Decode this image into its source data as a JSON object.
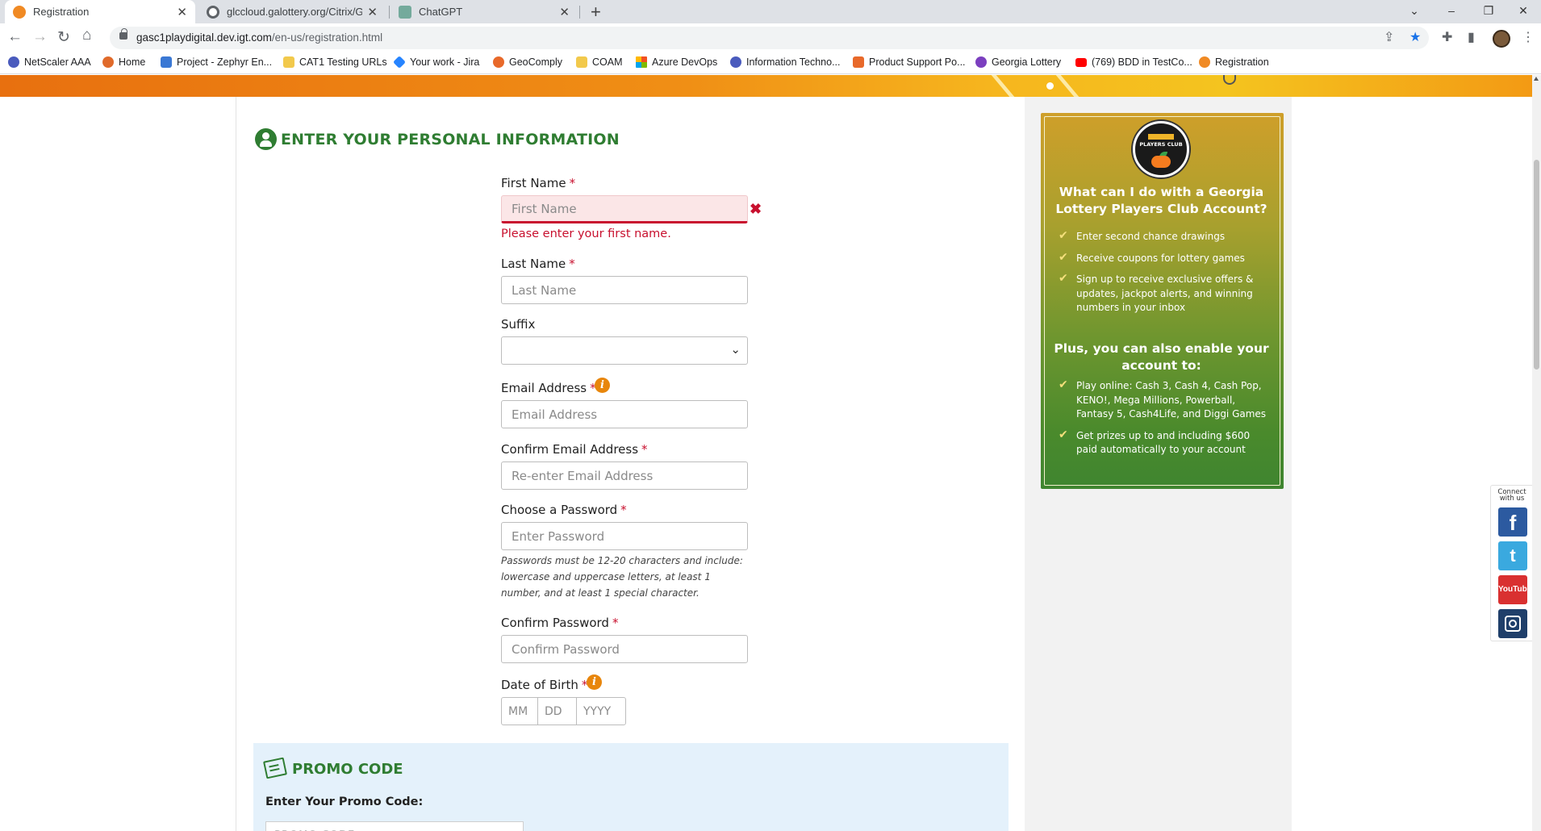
{
  "browser": {
    "tabs": [
      {
        "title": "Registration",
        "favicon_color": "#f08a24",
        "active": true
      },
      {
        "title": "glccloud.galottery.org/Citrix/GLC",
        "favicon_color": "#5f6368",
        "active": false
      },
      {
        "title": "ChatGPT",
        "favicon_color": "#74aa9c",
        "active": false
      }
    ],
    "url_host": "gasc1playdigital.dev.igt.com",
    "url_path": "/en-us/registration.html",
    "bookmarks": [
      {
        "label": "NetScaler AAA",
        "icon_color": "#4a5bbd"
      },
      {
        "label": "Home",
        "icon_color": "#e06a2a"
      },
      {
        "label": "Project - Zephyr En...",
        "icon_color": "#3a78d4"
      },
      {
        "label": "CAT1 Testing URLs",
        "icon_color": "#f2c94c"
      },
      {
        "label": "Your work - Jira",
        "icon_color": "#2684ff"
      },
      {
        "label": "GeoComply",
        "icon_color": "#e8692a"
      },
      {
        "label": "COAM",
        "icon_color": "#f2c94c"
      },
      {
        "label": "Azure DevOps",
        "icon_color": "#00a4ef"
      },
      {
        "label": "Information Techno...",
        "icon_color": "#4a5bbd"
      },
      {
        "label": "Product Support Po...",
        "icon_color": "#e8692a"
      },
      {
        "label": "Georgia Lottery",
        "icon_color": "#7b3fbf"
      },
      {
        "label": "(769) BDD in TestCo...",
        "icon_color": "#ff0000"
      },
      {
        "label": "Registration",
        "icon_color": "#f08a24"
      }
    ]
  },
  "form": {
    "section_title": "ENTER YOUR PERSONAL INFORMATION",
    "first_name": {
      "label": "First Name",
      "placeholder": "First Name",
      "value": "",
      "error": "Please enter your first name."
    },
    "last_name": {
      "label": "Last Name",
      "placeholder": "Last Name",
      "value": ""
    },
    "suffix": {
      "label": "Suffix",
      "selected": ""
    },
    "email": {
      "label": "Email Address",
      "placeholder": "Email Address",
      "value": ""
    },
    "confirm_email": {
      "label": "Confirm Email Address",
      "placeholder": "Re-enter Email Address",
      "value": ""
    },
    "password": {
      "label": "Choose a Password",
      "placeholder": "Enter Password",
      "value": "",
      "hint": "Passwords must be 12-20 characters and include: lowercase and uppercase letters, at least 1 number, and at least 1 special character."
    },
    "confirm_password": {
      "label": "Confirm Password",
      "placeholder": "Confirm Password",
      "value": ""
    },
    "dob": {
      "label": "Date of Birth",
      "mm_placeholder": "MM",
      "dd_placeholder": "DD",
      "yyyy_placeholder": "YYYY"
    },
    "required_mark": "*",
    "error_mark": "✖",
    "info_glyph": "i"
  },
  "promo": {
    "title": "PROMO CODE",
    "label": "Enter Your Promo Code:",
    "placeholder": "PROMO CODE"
  },
  "players_club": {
    "badge_text": "PLAYERS CLUB",
    "heading": "What can I do with a Georgia Lottery Players Club Account?",
    "benefits": [
      "Enter second chance drawings",
      "Receive coupons for lottery games",
      "Sign up to receive exclusive offers & updates, jackpot alerts, and winning numbers in your inbox"
    ],
    "subheading": "Plus, you can also enable your account to:",
    "extras": [
      "Play online: Cash 3, Cash 4, Cash Pop, KENO!, Mega Millions, Powerball, Fantasy 5, Cash4Life, and Diggi Games",
      "Get prizes up to and including $600 paid automatically to your account"
    ],
    "check_glyph": "✔"
  },
  "social": {
    "connect_label": "Connect with us",
    "facebook": "f",
    "twitter": "t",
    "youtube": "YouTube"
  },
  "colors": {
    "brand_green": "#2f7d32",
    "error_red": "#c8102e",
    "info_orange": "#e8860c",
    "promo_bg": "#e4f1fb"
  }
}
